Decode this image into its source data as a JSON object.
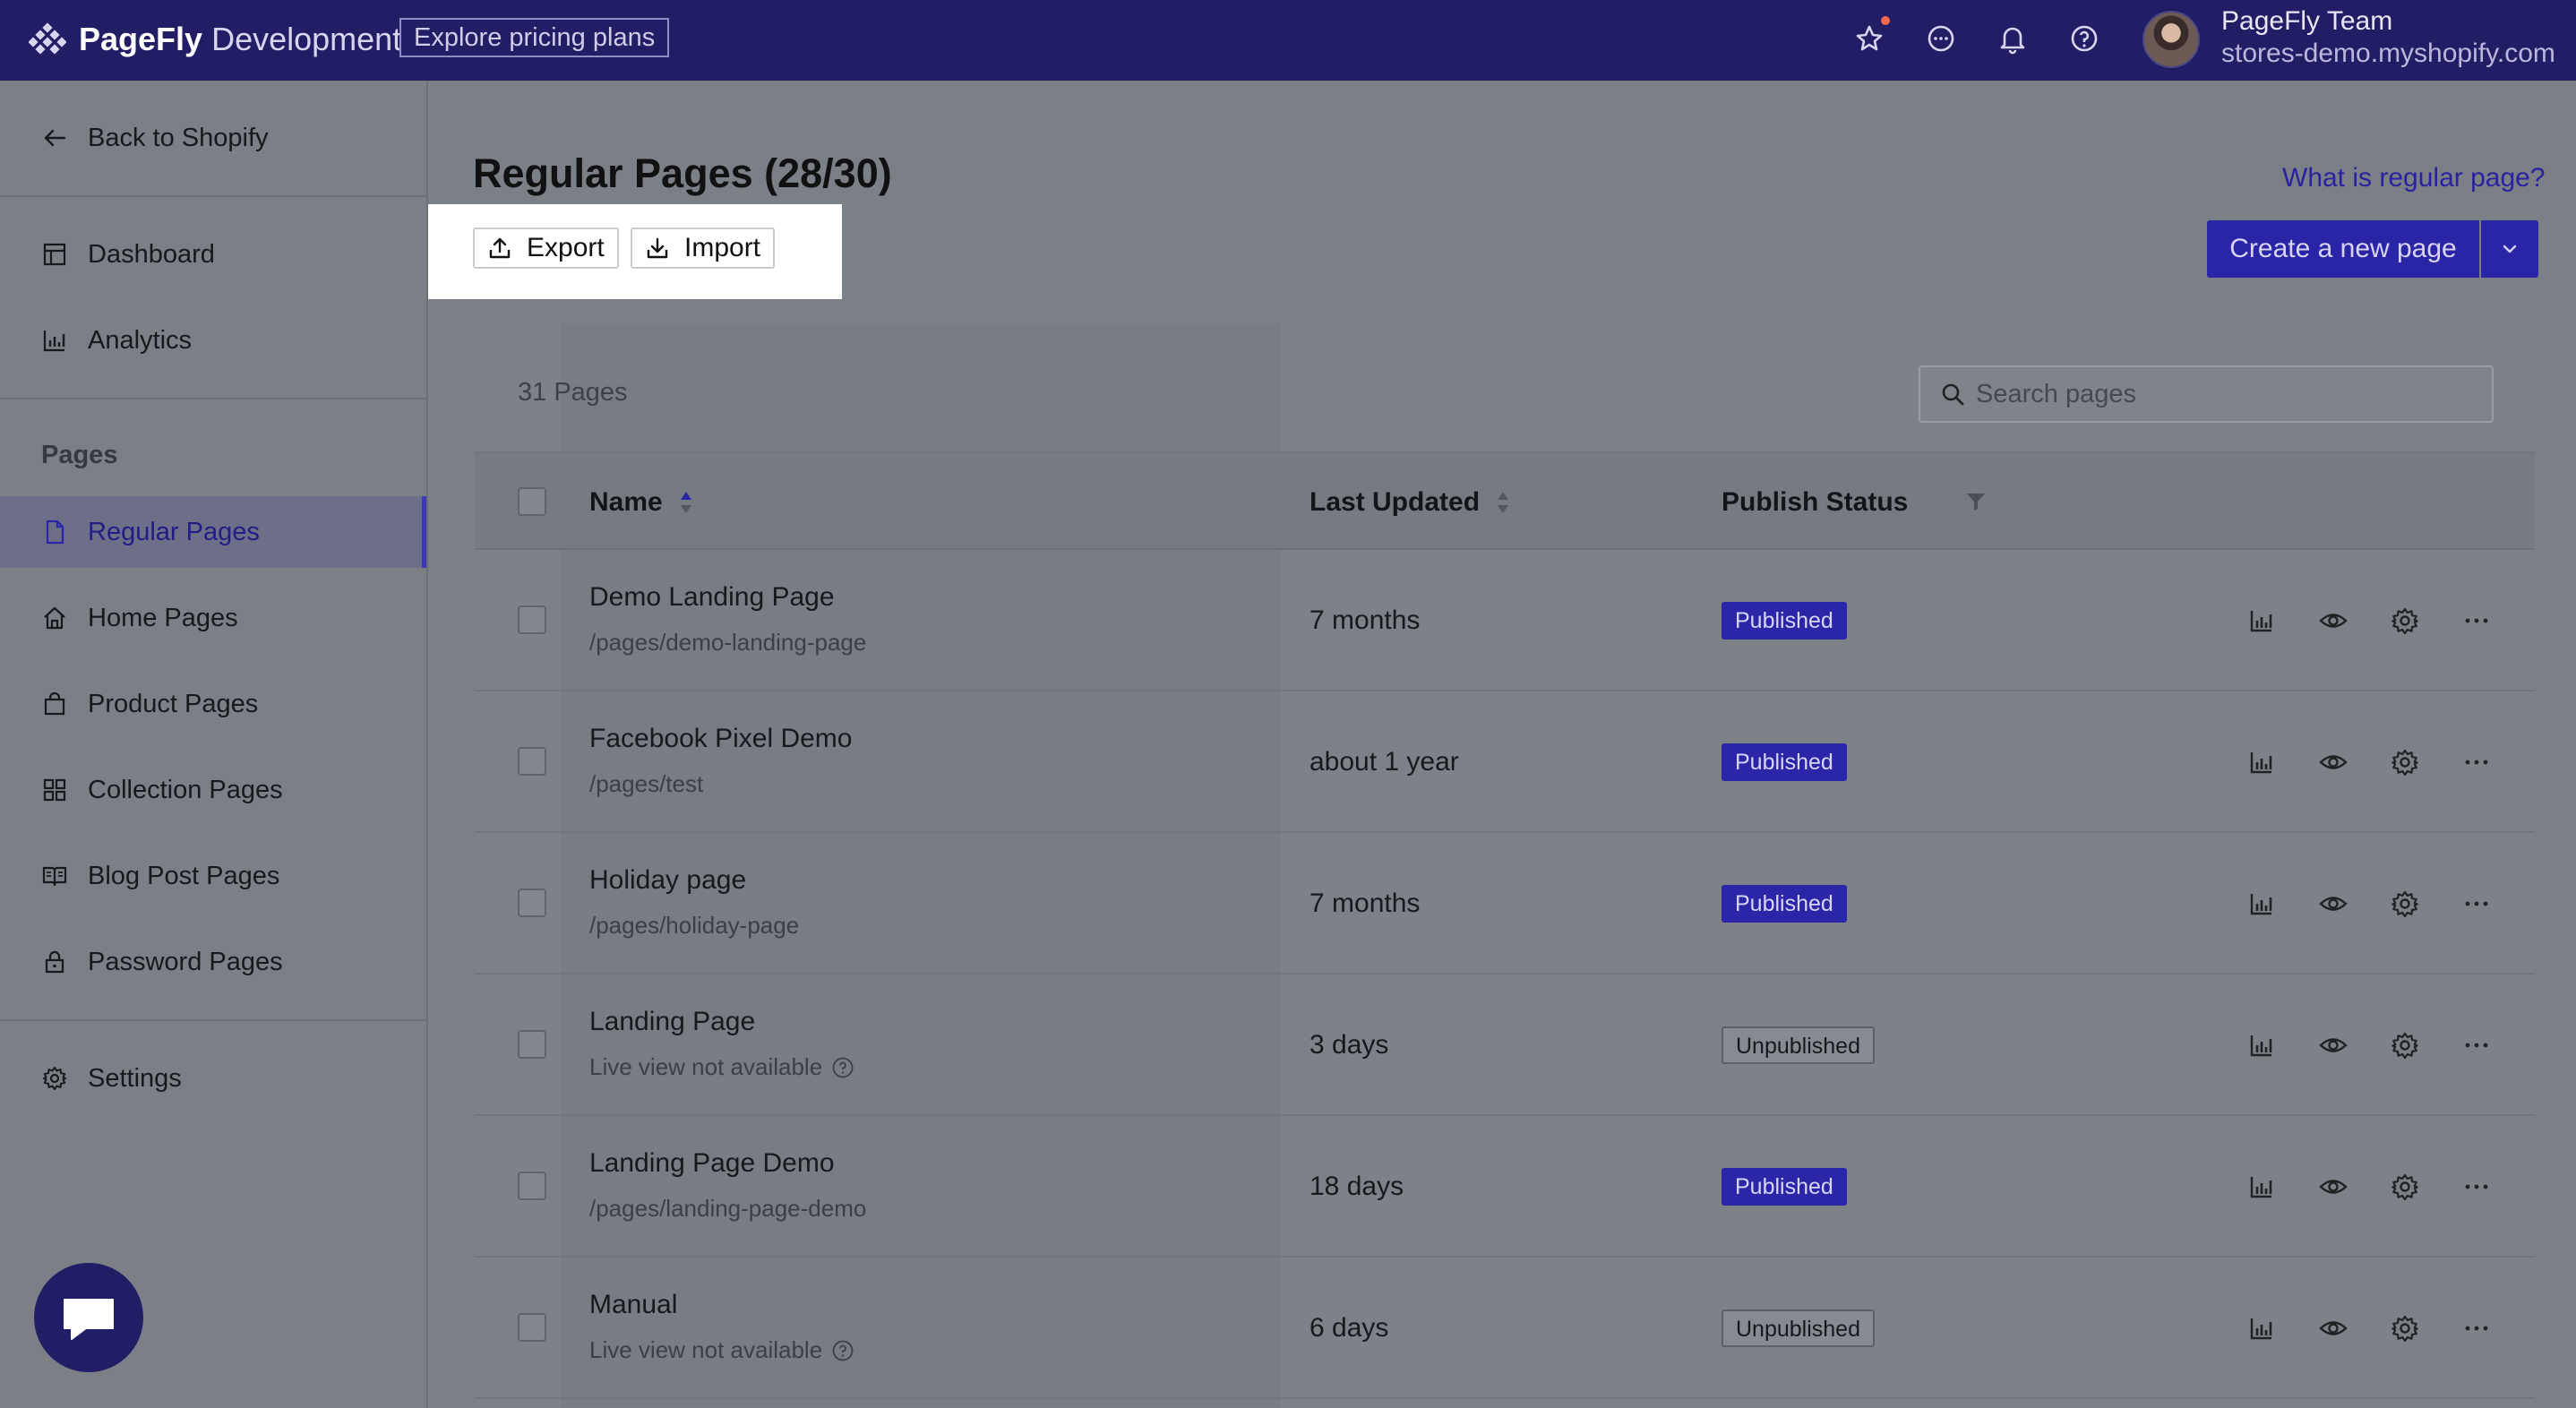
{
  "topbar": {
    "brand_bold": "PageFly",
    "brand_light": " Development",
    "pricing_label": "Explore pricing plans",
    "team_name": "PageFly Team",
    "store_url": "stores-demo.myshopify.com"
  },
  "sidebar": {
    "back_label": "Back to Shopify",
    "dashboard_label": "Dashboard",
    "analytics_label": "Analytics",
    "pages_heading": "Pages",
    "items": [
      {
        "label": "Regular Pages",
        "icon": "page-icon"
      },
      {
        "label": "Home Pages",
        "icon": "home-icon"
      },
      {
        "label": "Product Pages",
        "icon": "bag-icon"
      },
      {
        "label": "Collection Pages",
        "icon": "grid-icon"
      },
      {
        "label": "Blog Post Pages",
        "icon": "book-icon"
      },
      {
        "label": "Password Pages",
        "icon": "lock-icon"
      }
    ],
    "settings_label": "Settings"
  },
  "main": {
    "title": "Regular Pages (28/30)",
    "help_link": "What is regular page?",
    "export_label": "Export",
    "import_label": "Import",
    "create_label": "Create a new page"
  },
  "table": {
    "count_label": "31 Pages",
    "search_placeholder": "Search pages",
    "col_name": "Name",
    "col_updated": "Last Updated",
    "col_status": "Publish Status",
    "rows": [
      {
        "title": "Demo Landing Page",
        "sub": "/pages/demo-landing-page",
        "updated": "7 months",
        "status": "Published"
      },
      {
        "title": "Facebook Pixel Demo",
        "sub": "/pages/test",
        "updated": "about 1 year",
        "status": "Published"
      },
      {
        "title": "Holiday page",
        "sub": "/pages/holiday-page",
        "updated": "7 months",
        "status": "Published"
      },
      {
        "title": "Landing Page",
        "sub": "Live view not available",
        "updated": "3 days",
        "status": "Unpublished"
      },
      {
        "title": "Landing Page Demo",
        "sub": "/pages/landing-page-demo",
        "updated": "18 days",
        "status": "Published"
      },
      {
        "title": "Manual",
        "sub": "Live view not available",
        "updated": "6 days",
        "status": "Unpublished"
      }
    ]
  },
  "colors": {
    "brand": "#221e66",
    "accent": "#2a24a6",
    "notification": "#f26b4e"
  }
}
